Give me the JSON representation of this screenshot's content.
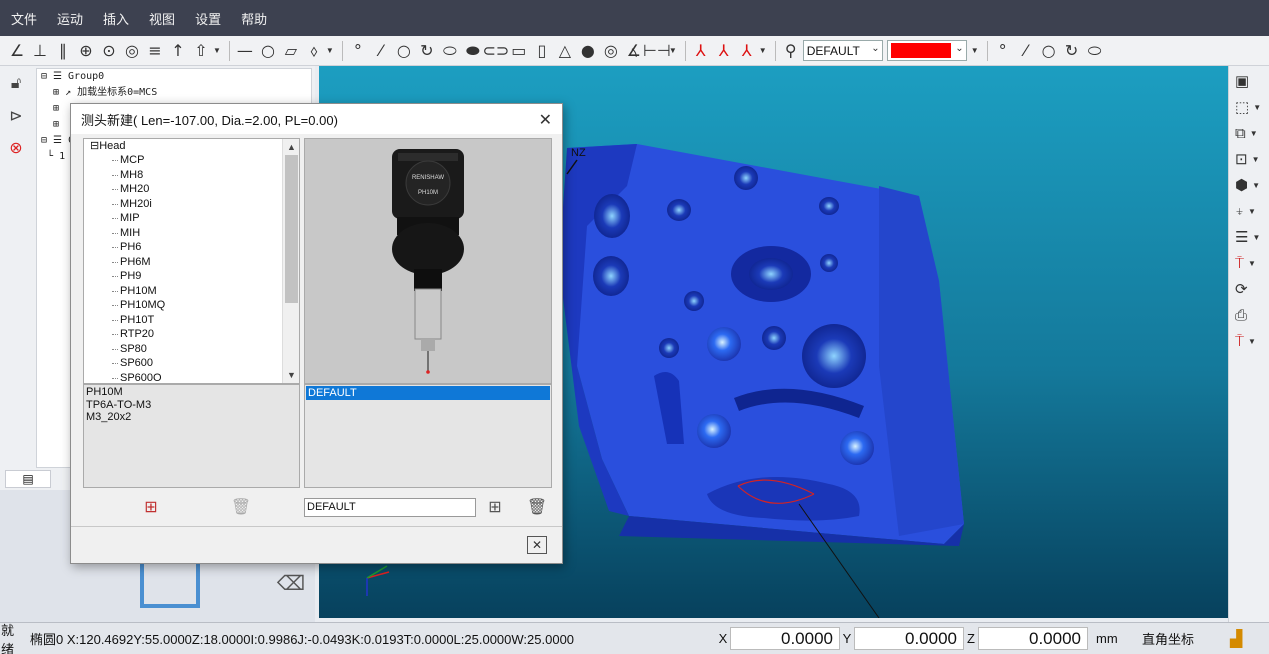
{
  "menubar": {
    "items": [
      "文件",
      "运动",
      "插入",
      "视图",
      "设置",
      "帮助"
    ]
  },
  "toolbar": {
    "groups": [
      [
        "angle-icon",
        "perpendicular-icon",
        "parallel-icon",
        "crosshair-icon",
        "circle-point-icon",
        "concentric-icon",
        "equal-icon",
        "arrow-up-icon",
        "arrow-up-outline-icon"
      ],
      [
        "line-icon",
        "circle-icon",
        "parallelogram-icon",
        "ellipse-arrow-icon"
      ],
      [
        "point-icon",
        "line-feature-icon",
        "circle-feature-icon",
        "arc-feature-icon",
        "ellipse-feature-icon",
        "plane-feature-icon",
        "slot-feature-icon",
        "rect-slot-icon",
        "cylinder-icon",
        "cone-icon",
        "sphere-icon",
        "torus-icon",
        "angle-measure-icon",
        "distance-icon"
      ],
      [
        "axis-icon",
        "axis-red-icon",
        "axis-translate-icon"
      ]
    ],
    "layer_combo": "DEFAULT",
    "color_value": "#ff0000"
  },
  "left": {
    "tree": {
      "rows": [
        "Group0",
        "加载坐标系0=MCS",
        "",
        "",
        "C",
        "1"
      ]
    }
  },
  "dialog": {
    "title": "测头新建( Len=-107.00, Dia.=2.00, PL=0.00)",
    "head_root": "Head",
    "heads": [
      "MCP",
      "MH8",
      "MH20",
      "MH20i",
      "MIP",
      "MIH",
      "PH6",
      "PH6M",
      "PH9",
      "PH10M",
      "PH10MQ",
      "PH10T",
      "RTP20",
      "SP80",
      "SP600",
      "SP600O"
    ],
    "preview_brand": "RENISHAW",
    "preview_model": "PH10M",
    "config_items": [
      "PH10M",
      "TP6A-TO-M3",
      "M3_20x2"
    ],
    "tip_items": [
      "DEFAULT"
    ],
    "name_value": "DEFAULT"
  },
  "viewport": {
    "axis_label": "NZ",
    "bg_top": "#1c9ec1",
    "part_color": "#2b54e0"
  },
  "statusbar": {
    "ready": "就绪",
    "info": "椭圆0  X:120.4692Y:55.0000Z:18.0000I:0.9986J:-0.0493K:0.0193T:0.0000L:25.0000W:25.0000",
    "x_label": "X",
    "x_value": "0.0000",
    "y_label": "Y",
    "y_value": "0.0000",
    "z_label": "Z",
    "z_value": "0.0000",
    "unit": "mm",
    "coord_mode": "直角坐标"
  }
}
